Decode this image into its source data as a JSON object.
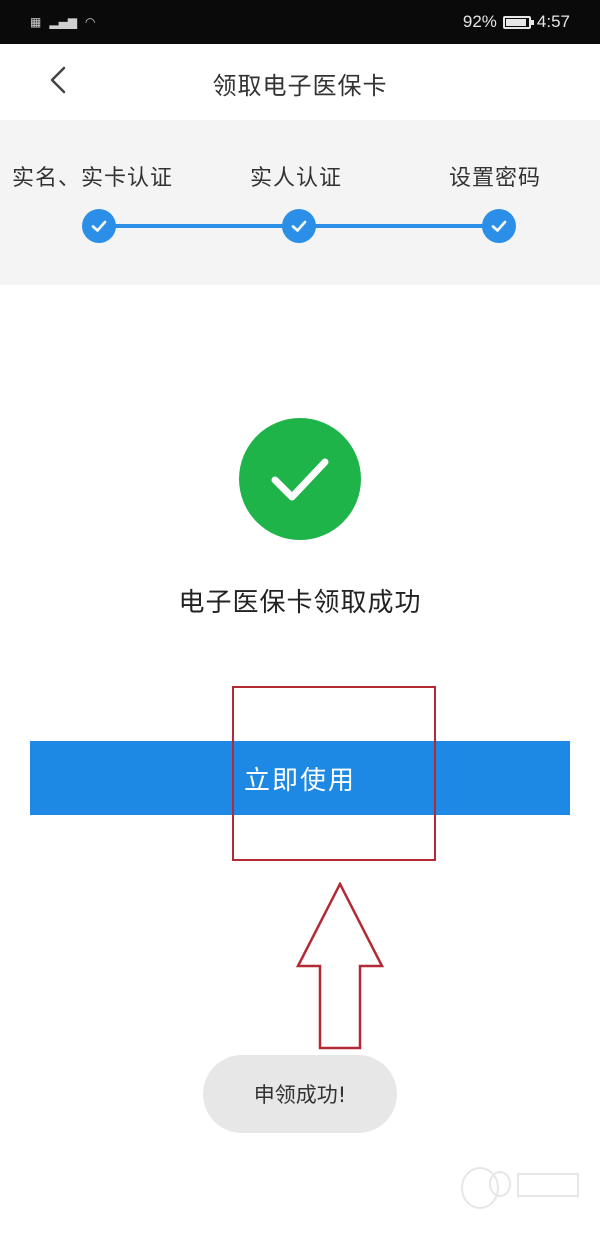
{
  "status_bar": {
    "battery": "92%",
    "time": "4:57",
    "left_icons": [
      "sim-icon",
      "signal-icon",
      "wifi-icon"
    ]
  },
  "nav": {
    "title": "领取电子医保卡",
    "back_icon": "chevron-left-icon"
  },
  "steps": [
    {
      "label": "实名、实卡认证",
      "done": true
    },
    {
      "label": "实人认证",
      "done": true
    },
    {
      "label": "设置密码",
      "done": true
    }
  ],
  "result": {
    "message": "电子医保卡领取成功",
    "icon": "check-circle-icon"
  },
  "primary_button": {
    "label": "立即使用"
  },
  "toast": {
    "message": "申领成功!"
  },
  "colors": {
    "accent": "#1e88e5",
    "success": "#1fb44a",
    "annotation": "#b32a37"
  }
}
